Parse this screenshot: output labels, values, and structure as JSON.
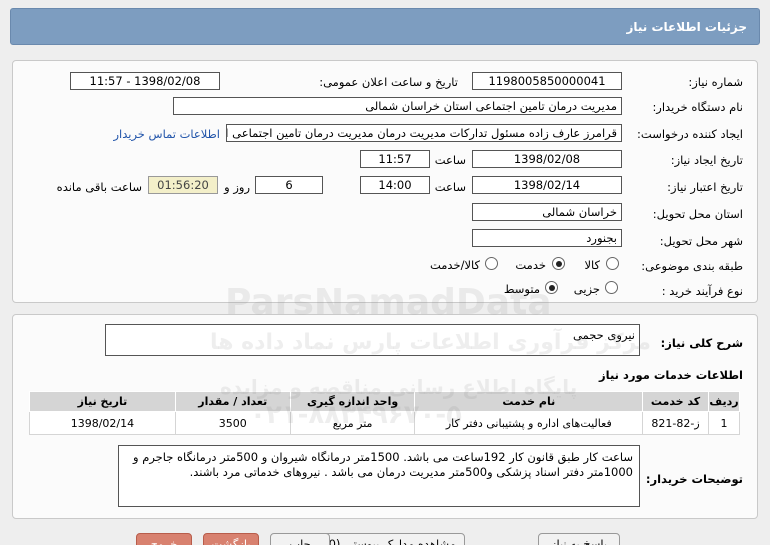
{
  "header": {
    "title": "جزئیات اطلاعات نیاز"
  },
  "fields": {
    "need_number_label": "شماره نیاز:",
    "need_number": "1198005850000041",
    "announce_label": "تاریخ و ساعت اعلان عمومی:",
    "announce_value": "1398/02/08 - 11:57",
    "buyer_org_label": "نام دستگاه خریدار:",
    "buyer_org": "مدیریت درمان تامین اجتماعی استان خراسان شمالی",
    "requester_label": "ایجاد کننده درخواست:",
    "requester": "قرامرز عارف زاده  مسئول تدارکات مدیریت درمان مدیریت درمان تامین اجتماعی ا",
    "contact_link": "اطلاعات تماس خریدار",
    "created_label": "تاریخ ایجاد نیاز:",
    "created_date": "1398/02/08",
    "time_label": "ساعت",
    "created_time": "11:57",
    "valid_label": "تاریخ اعتبار نیاز:",
    "valid_date": "1398/02/14",
    "valid_time": "14:00",
    "days_value": "6",
    "days_label": "روز و",
    "remaining_value": "01:56:20",
    "remaining_label": "ساعت باقی مانده",
    "province_label": "استان محل تحویل:",
    "province": "خراسان شمالی",
    "city_label": "شهر محل تحویل:",
    "city": "بجنورد",
    "category_label": "طبقه بندی موضوعی:",
    "category_options": [
      "کالا",
      "خدمت",
      "کالا/خدمت"
    ],
    "process_label": "نوع فرآیند خرید :",
    "process_options": [
      "جزیی",
      "متوسط"
    ]
  },
  "summary": {
    "label": "شرح کلی نیاز:",
    "value": "نیروی حجمی"
  },
  "services": {
    "title": "اطلاعات خدمات مورد نیاز",
    "headers": [
      "ردیف",
      "کد خدمت",
      "نام خدمت",
      "واحد اندازه گیری",
      "تعداد / مقدار",
      "تاریخ نیاز"
    ],
    "rows": [
      [
        "1",
        "ز-82-821",
        "فعالیت‌های اداره و پشتیبانی دفتر کار",
        "متر مربع",
        "3500",
        "1398/02/14"
      ]
    ]
  },
  "notes": {
    "label": "توضیحات خریدار:",
    "value": "ساعت کار طبق قانون کار 192ساعت می باشد. 1500متر درمانگاه شیروان و 500متر درمانگاه جاجرم و 1000متر دفتر اسناد پزشکی و500متر مدیریت درمان می باشد . نیروهای خدماتی مرد باشند."
  },
  "buttons": {
    "reply": "پاسخ به نیاز",
    "documents": "مشاهده مدارک پیوستی (0)",
    "print": "چاپ",
    "back": "بازگشت",
    "exit": "خروج"
  },
  "watermark": {
    "latin": "ParsNamadData",
    "line1": "مرکز فرآوری اطلاعات پارس نماد داده ها",
    "line2": "پایگاه اطلاع رسانی مناقصه و مزایده",
    "phone": "۰۲۱-۸۸۳۴۹۶۷۰-۵"
  },
  "colors": {
    "header": "#7d9dc0",
    "link": "#2255aa",
    "remaining": "#f3efc9"
  }
}
